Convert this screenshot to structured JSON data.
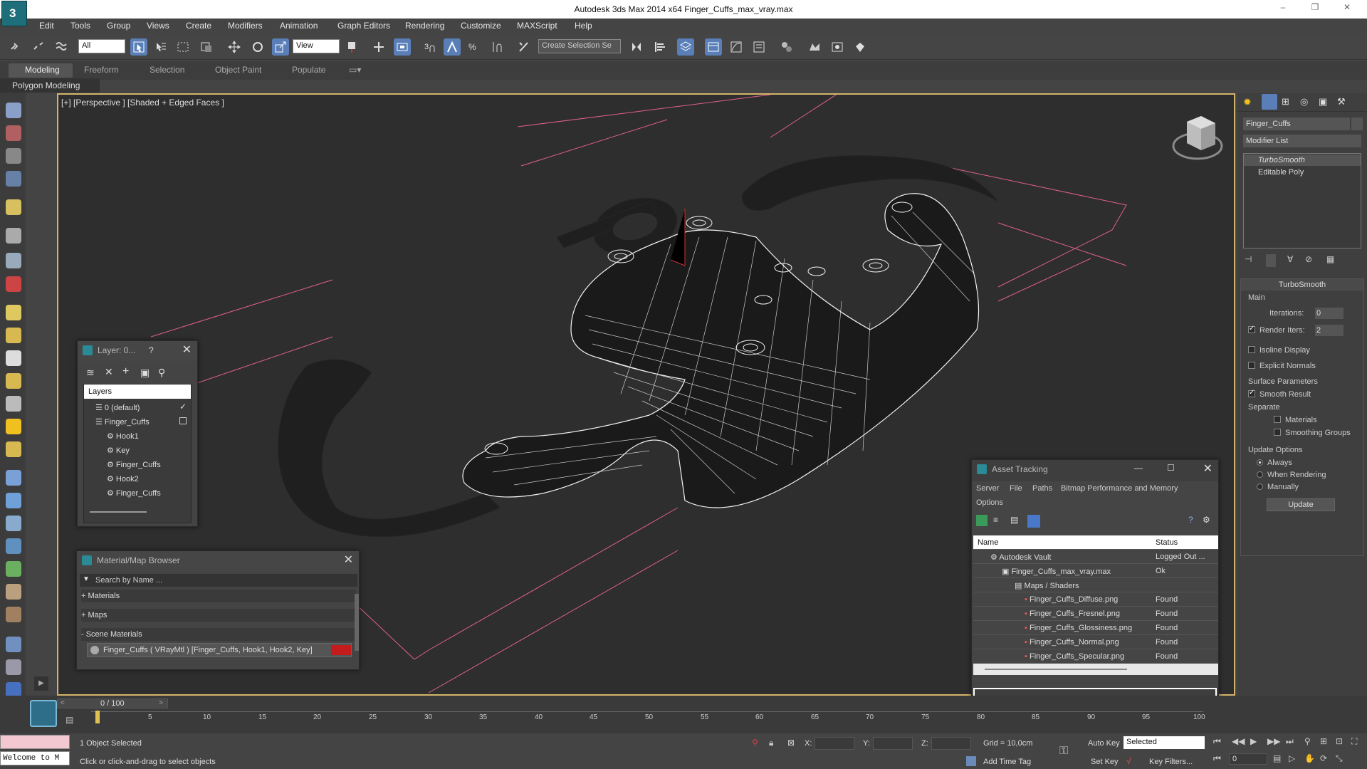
{
  "app": {
    "title": "Autodesk 3ds Max  2014 x64     Finger_Cuffs_max_vray.max",
    "logo_text": "3",
    "window_controls": [
      "–",
      "❐",
      "✕"
    ]
  },
  "menubar": [
    "Edit",
    "Tools",
    "Group",
    "Views",
    "Create",
    "Modifiers",
    "Animation",
    "Graph Editors",
    "Rendering",
    "Customize",
    "MAXScript",
    "Help"
  ],
  "toolbar": {
    "selection_filter": "All",
    "coord_system": "View",
    "named_selection_placeholder": "Create Selection Se"
  },
  "ribbon": {
    "tabs": [
      "Modeling",
      "Freeform",
      "Selection",
      "Object Paint",
      "Populate"
    ],
    "active_tab": "Modeling",
    "sub_label": "Polygon Modeling"
  },
  "viewport": {
    "label": "[+] [Perspective ] [Shaded + Edged Faces ]"
  },
  "layer_dialog": {
    "title": "Layer: 0...",
    "help": "?",
    "header": "Layers",
    "items": [
      "0 (default)",
      "Finger_Cuffs",
      "Hook1",
      "Key",
      "Finger_Cuffs",
      "Hook2",
      "Finger_Cuffs"
    ]
  },
  "material_browser": {
    "title": "Material/Map Browser",
    "search_placeholder": "Search by Name ...",
    "sections": [
      "+ Materials",
      "+ Maps",
      "- Scene Materials"
    ],
    "scene_material": "Finger_Cuffs  ( VRayMtl )  [Finger_Cuffs, Hook1, Hook2, Key]"
  },
  "asset_tracking": {
    "title": "Asset Tracking",
    "menu": [
      "Server",
      "File",
      "Paths",
      "Bitmap Performance and Memory",
      "Options"
    ],
    "columns": [
      "Name",
      "Status"
    ],
    "rows": [
      {
        "name": "Autodesk Vault",
        "status": "Logged Out ..."
      },
      {
        "name": "Finger_Cuffs_max_vray.max",
        "status": "Ok"
      },
      {
        "name": "Maps / Shaders",
        "status": ""
      },
      {
        "name": "Finger_Cuffs_Diffuse.png",
        "status": "Found"
      },
      {
        "name": "Finger_Cuffs_Fresnel.png",
        "status": "Found"
      },
      {
        "name": "Finger_Cuffs_Glossiness.png",
        "status": "Found"
      },
      {
        "name": "Finger_Cuffs_Normal.png",
        "status": "Found"
      },
      {
        "name": "Finger_Cuffs_Specular.png",
        "status": "Found"
      }
    ]
  },
  "command_panel": {
    "object_name": "Finger_Cuffs",
    "modifier_list": "Modifier List",
    "stack": [
      "TurboSmooth",
      "Editable Poly"
    ],
    "rollout_title": "TurboSmooth",
    "main_label": "Main",
    "iterations_label": "Iterations:",
    "iterations_value": "0",
    "render_iters_label": "Render Iters:",
    "render_iters_value": "2",
    "isoline": "Isoline Display",
    "explicit_normals": "Explicit Normals",
    "surface_params": "Surface Parameters",
    "smooth_result": "Smooth Result",
    "separate": "Separate",
    "materials": "Materials",
    "smoothing_groups": "Smoothing Groups",
    "update_options": "Update Options",
    "always": "Always",
    "when_rendering": "When Rendering",
    "manually": "Manually",
    "update_button": "Update"
  },
  "timeline": {
    "frame_counter": "0 / 100",
    "ticks": [
      "5",
      "10",
      "15",
      "20",
      "25",
      "30",
      "35",
      "40",
      "45",
      "50",
      "55",
      "60",
      "65",
      "70",
      "75",
      "80",
      "85",
      "90",
      "95",
      "100"
    ]
  },
  "status": {
    "welcome": "Welcome to M",
    "objects_selected": "1 Object Selected",
    "prompt": "Click or click-and-drag to select objects",
    "x_label": "X:",
    "y_label": "Y:",
    "z_label": "Z:",
    "grid": "Grid = 10,0cm",
    "add_time_tag": "Add Time Tag",
    "auto_key": "Auto Key",
    "set_key": "Set Key",
    "selected": "Selected",
    "key_filters": "Key Filters...",
    "frame": "0"
  },
  "colors": {
    "accent_yellow": "#d4b46a",
    "vault_blue": "#2a8a96",
    "material_red": "#c41c1c",
    "grid_pink": "#e0608a"
  }
}
